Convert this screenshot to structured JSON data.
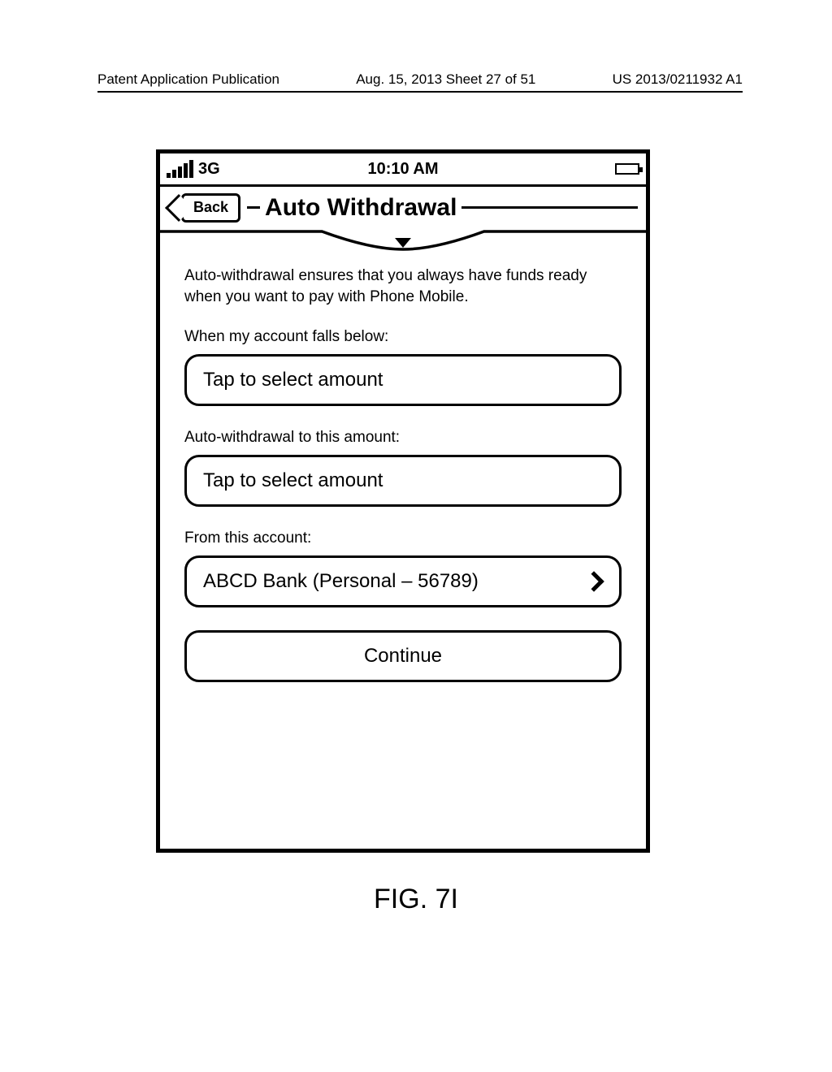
{
  "header": {
    "left": "Patent Application Publication",
    "mid": "Aug. 15, 2013  Sheet 27 of 51",
    "right": "US 2013/0211932 A1"
  },
  "statusbar": {
    "network": "3G",
    "time": "10:10 AM"
  },
  "navbar": {
    "back": "Back",
    "title": "Auto Withdrawal"
  },
  "body": {
    "blurb": "Auto-withdrawal ensures that you always have funds ready when you want to pay with Phone Mobile.",
    "label_threshold": "When my account falls below:",
    "input_threshold": "Tap to select amount",
    "label_target": "Auto-withdrawal to this amount:",
    "input_target": "Tap to select amount",
    "label_account": "From this account:",
    "account_value": "ABCD Bank (Personal – 56789)",
    "continue": "Continue"
  },
  "figure_label": "FIG. 7I"
}
